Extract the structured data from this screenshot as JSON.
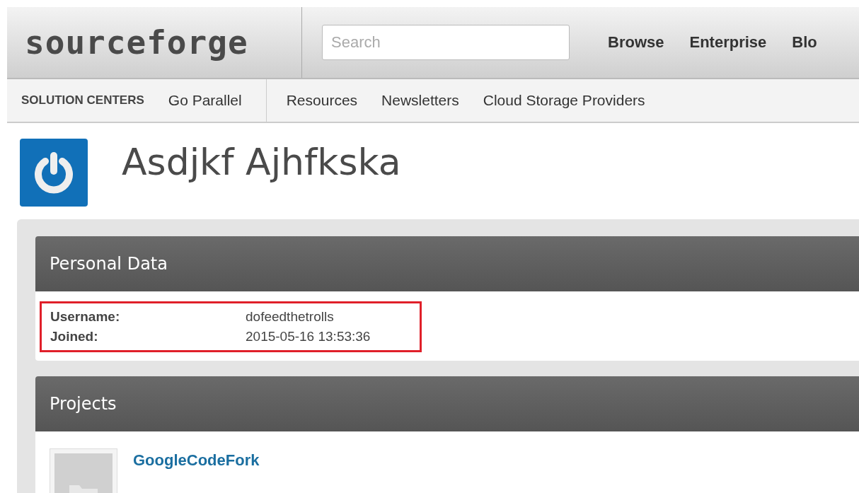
{
  "header": {
    "logo": "sourceforge",
    "search": {
      "placeholder": "Search"
    },
    "nav": [
      "Browse",
      "Enterprise",
      "Blo"
    ]
  },
  "subnav": {
    "label": "SOLUTION CENTERS",
    "items": [
      "Go Parallel"
    ],
    "links": [
      "Resources",
      "Newsletters",
      "Cloud Storage Providers"
    ]
  },
  "profile": {
    "name": "Asdjkf Ajhfkska"
  },
  "personal_data": {
    "title": "Personal Data",
    "highlighted": true,
    "fields": [
      {
        "label": "Username:",
        "value": "dofeedthetrolls"
      },
      {
        "label": "Joined:",
        "value": "2015-05-16 13:53:36"
      }
    ]
  },
  "projects": {
    "title": "Projects",
    "items": [
      {
        "name": "GoogleCodeFork"
      }
    ]
  }
}
